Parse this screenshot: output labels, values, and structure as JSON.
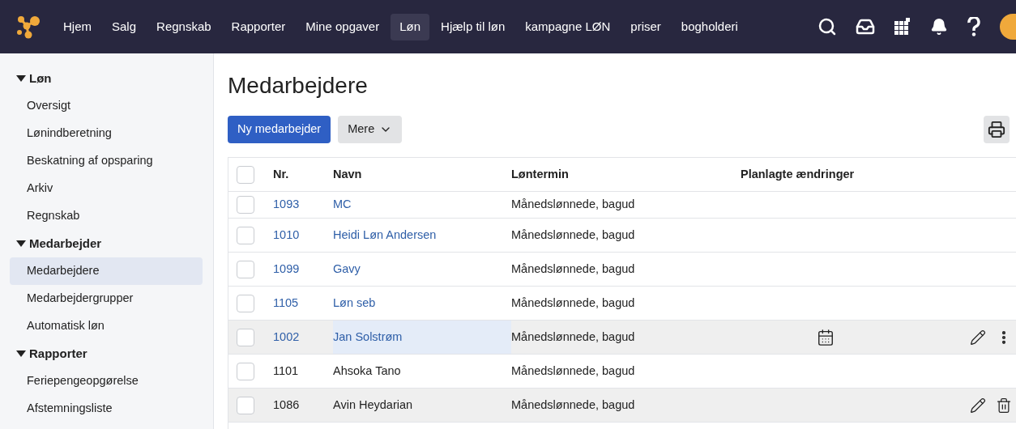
{
  "nav": {
    "items": [
      {
        "label": "Hjem",
        "selected": false
      },
      {
        "label": "Salg",
        "selected": false
      },
      {
        "label": "Regnskab",
        "selected": false
      },
      {
        "label": "Rapporter",
        "selected": false
      },
      {
        "label": "Mine opgaver",
        "selected": false
      },
      {
        "label": "Løn",
        "selected": true
      },
      {
        "label": "Hjælp til løn",
        "selected": false
      },
      {
        "label": "kampagne LØN",
        "selected": false
      },
      {
        "label": "priser",
        "selected": false
      },
      {
        "label": "bogholderi",
        "selected": false
      }
    ]
  },
  "sidebar": {
    "sections": [
      {
        "label": "Løn",
        "expanded": true,
        "items": [
          {
            "label": "Oversigt",
            "selected": false
          },
          {
            "label": "Lønindberetning",
            "selected": false
          },
          {
            "label": "Beskatning af opsparing",
            "selected": false
          },
          {
            "label": "Arkiv",
            "selected": false
          },
          {
            "label": "Regnskab",
            "selected": false
          }
        ]
      },
      {
        "label": "Medarbejder",
        "expanded": true,
        "items": [
          {
            "label": "Medarbejdere",
            "selected": true
          },
          {
            "label": "Medarbejdergrupper",
            "selected": false
          },
          {
            "label": "Automatisk løn",
            "selected": false
          }
        ]
      },
      {
        "label": "Rapporter",
        "expanded": true,
        "items": [
          {
            "label": "Feriepengeopgørelse",
            "selected": false
          },
          {
            "label": "Afstemningsliste",
            "selected": false
          }
        ]
      }
    ]
  },
  "page": {
    "title": "Medarbejdere",
    "primary_button": "Ny medarbejder",
    "more_button": "Mere"
  },
  "table": {
    "columns": [
      "Nr.",
      "Navn",
      "Løntermin",
      "Planlagte ændringer"
    ],
    "header_checked": false,
    "rows": [
      {
        "nr": "1093",
        "name": "MC",
        "term": "Månedslønnede, bagud",
        "kind": "link",
        "checked": false,
        "highlighted": false,
        "name_focused": false,
        "planned": false,
        "edit": false,
        "more_menu": false,
        "deletable": false
      },
      {
        "nr": "1010",
        "name": "Heidi Løn Andersen",
        "term": "Månedslønnede, bagud",
        "kind": "link",
        "checked": false,
        "highlighted": false,
        "name_focused": false,
        "planned": false,
        "edit": false,
        "more_menu": false,
        "deletable": false
      },
      {
        "nr": "1099",
        "name": "Gavy",
        "term": "Månedslønnede, bagud",
        "kind": "link",
        "checked": false,
        "highlighted": false,
        "name_focused": false,
        "planned": false,
        "edit": false,
        "more_menu": false,
        "deletable": false
      },
      {
        "nr": "1105",
        "name": "Løn seb",
        "term": "Månedslønnede, bagud",
        "kind": "link",
        "checked": false,
        "highlighted": false,
        "name_focused": false,
        "planned": false,
        "edit": false,
        "more_menu": false,
        "deletable": false
      },
      {
        "nr": "1002",
        "name": "Jan Solstrøm",
        "term": "Månedslønnede, bagud",
        "kind": "link",
        "checked": false,
        "highlighted": true,
        "name_focused": true,
        "planned": true,
        "edit": true,
        "more_menu": true,
        "deletable": false
      },
      {
        "nr": "1101",
        "name": "Ahsoka Tano",
        "term": "Månedslønnede, bagud",
        "kind": "plain",
        "checked": false,
        "highlighted": false,
        "name_focused": false,
        "planned": false,
        "edit": false,
        "more_menu": false,
        "deletable": false
      },
      {
        "nr": "1086",
        "name": "Avin Heydarian",
        "term": "Månedslønnede, bagud",
        "kind": "plain",
        "checked": false,
        "highlighted": true,
        "name_focused": false,
        "planned": false,
        "edit": true,
        "more_menu": false,
        "deletable": true
      }
    ]
  }
}
